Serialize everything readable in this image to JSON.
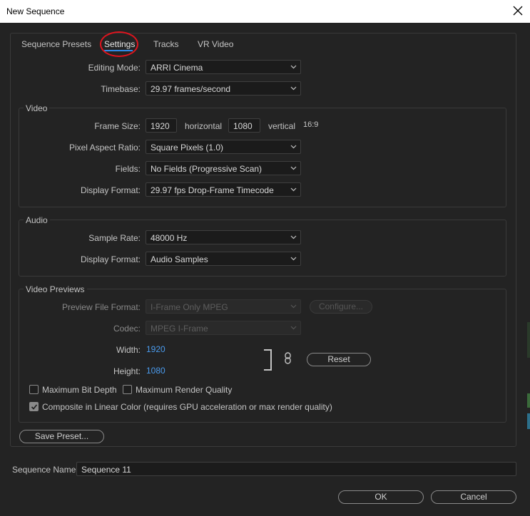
{
  "window": {
    "title": "New Sequence"
  },
  "tabs": [
    {
      "label": "Sequence Presets"
    },
    {
      "label": "Settings"
    },
    {
      "label": "Tracks"
    },
    {
      "label": "VR Video"
    }
  ],
  "general": {
    "editing_mode": {
      "label": "Editing Mode:",
      "value": "ARRI Cinema"
    },
    "timebase": {
      "label": "Timebase:",
      "value": "29.97  frames/second"
    }
  },
  "video": {
    "group_title": "Video",
    "frame_size": {
      "label": "Frame Size:",
      "width": "1920",
      "horizontal_label": "horizontal",
      "height": "1080",
      "vertical_label": "vertical",
      "aspect": "16:9"
    },
    "pixel_aspect_ratio": {
      "label": "Pixel Aspect Ratio:",
      "value": "Square Pixels (1.0)"
    },
    "fields": {
      "label": "Fields:",
      "value": "No Fields (Progressive Scan)"
    },
    "display_format": {
      "label": "Display Format:",
      "value": "29.97 fps Drop-Frame Timecode"
    }
  },
  "audio": {
    "group_title": "Audio",
    "sample_rate": {
      "label": "Sample Rate:",
      "value": "48000 Hz"
    },
    "display_format": {
      "label": "Display Format:",
      "value": "Audio Samples"
    }
  },
  "video_previews": {
    "group_title": "Video Previews",
    "preview_file_format": {
      "label": "Preview File Format:",
      "value": "I-Frame Only MPEG"
    },
    "configure_label": "Configure...",
    "codec": {
      "label": "Codec:",
      "value": "MPEG I-Frame"
    },
    "width": {
      "label": "Width:",
      "value": "1920"
    },
    "height": {
      "label": "Height:",
      "value": "1080"
    },
    "reset_label": "Reset",
    "max_bit_depth": {
      "label": "Maximum Bit Depth",
      "checked": false
    },
    "max_render_quality": {
      "label": "Maximum Render Quality",
      "checked": false
    },
    "composite_linear": {
      "label": "Composite in Linear Color (requires GPU acceleration or max render quality)",
      "checked": true
    }
  },
  "save_preset_label": "Save Preset...",
  "sequence_name": {
    "label": "Sequence Name:",
    "value": "Sequence 11"
  },
  "ok_label": "OK",
  "cancel_label": "Cancel",
  "colors": {
    "accent": "#2d8ceb",
    "highlight_circle": "#e0141e",
    "link_value": "#4b9cef",
    "background": "#232323"
  }
}
